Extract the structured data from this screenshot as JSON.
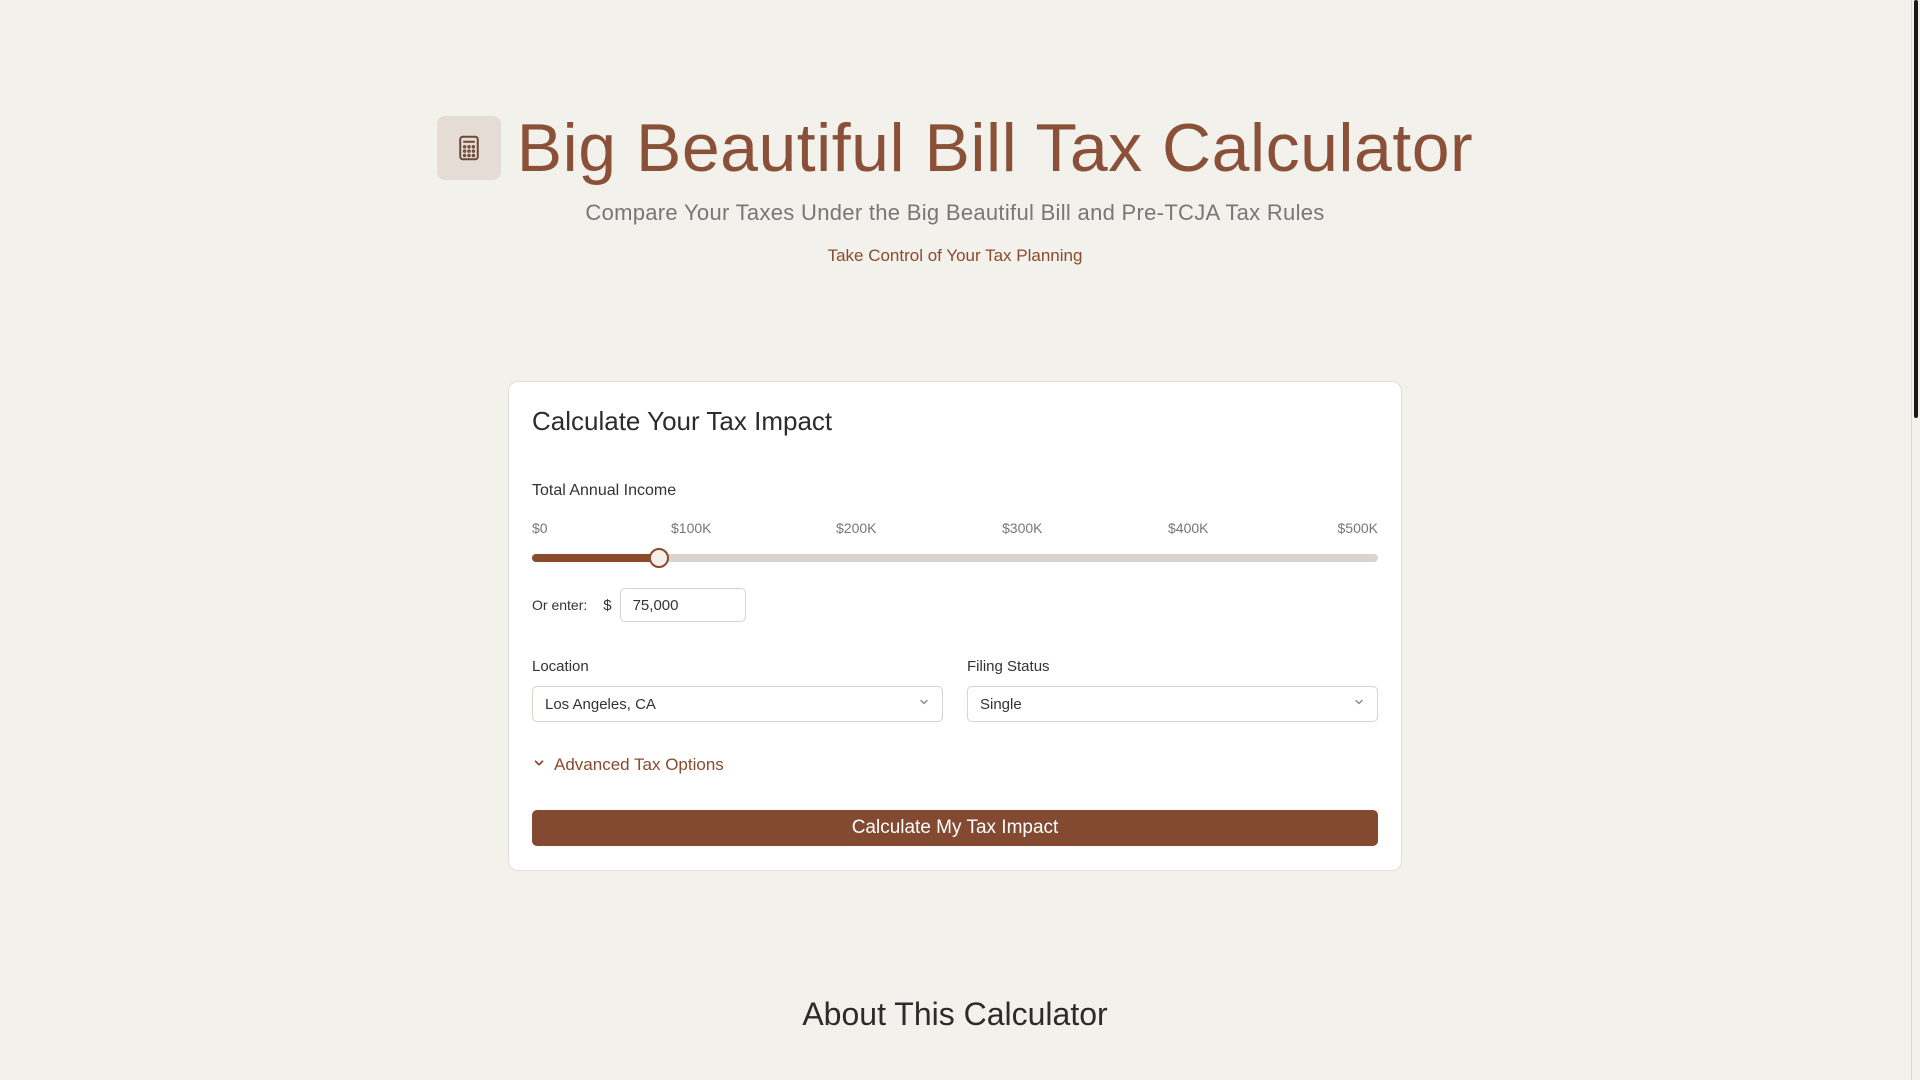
{
  "header": {
    "title": "Big Beautiful Bill Tax Calculator",
    "subtitle": "Compare Your Taxes Under the Big Beautiful Bill and Pre-TCJA Tax Rules",
    "tagline": "Take Control of Your Tax Planning",
    "icon": "calculator-icon"
  },
  "card": {
    "title": "Calculate Your Tax Impact",
    "income": {
      "label": "Total Annual Income",
      "ticks": [
        "$0",
        "$100K",
        "$200K",
        "$300K",
        "$400K",
        "$500K"
      ],
      "slider_min": 0,
      "slider_max": 500000,
      "slider_value": 75000,
      "or_enter_label": "Or enter:",
      "currency_symbol": "$",
      "input_value": "75,000"
    },
    "location": {
      "label": "Location",
      "selected": "Los Angeles, CA"
    },
    "filing_status": {
      "label": "Filing Status",
      "selected": "Single"
    },
    "advanced_label": "Advanced Tax Options",
    "button_label": "Calculate My Tax Impact"
  },
  "about": {
    "title": "About This Calculator"
  },
  "colors": {
    "accent": "#8a4a2c",
    "title": "#8a5138",
    "background": "#f3f1ec",
    "button": "#844a31"
  }
}
